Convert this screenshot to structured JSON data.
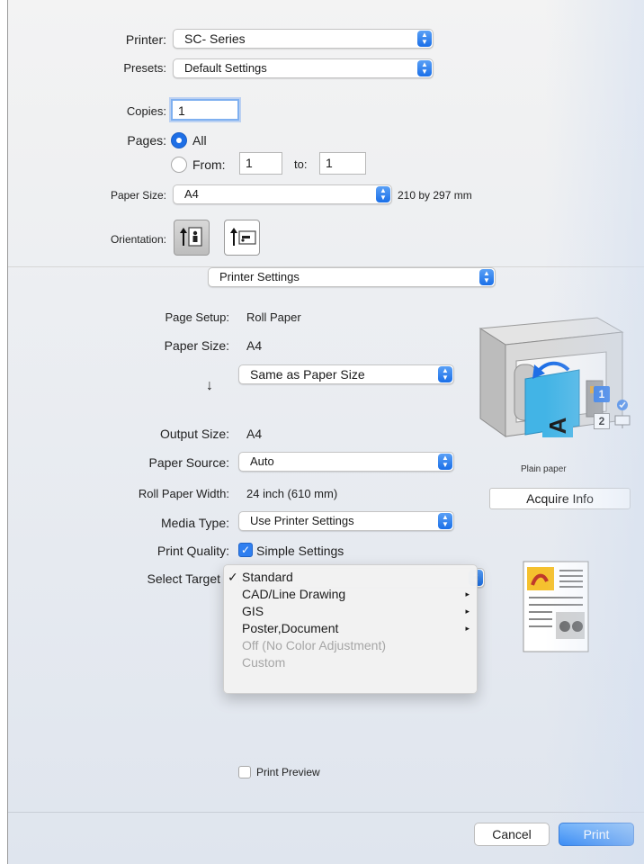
{
  "top": {
    "printer_label": "Printer:",
    "printer_value": "SC- Series",
    "presets_label": "Presets:",
    "presets_value": "Default Settings",
    "copies_label": "Copies:",
    "copies_value": "1",
    "pages_label": "Pages:",
    "pages_all": "All",
    "pages_from": "From:",
    "from_value": "1",
    "to_label": "to:",
    "to_value": "1",
    "paper_size_label": "Paper Size:",
    "paper_size_value": "A4",
    "paper_dims": "210 by 297 mm",
    "orientation_label": "Orientation:"
  },
  "panel_select": "Printer Settings",
  "settings": {
    "page_setup_label": "Page Setup:",
    "page_setup_value": "Roll Paper",
    "paper_size_label": "Paper Size:",
    "paper_size_value": "A4",
    "same_as_paper": "Same as Paper Size",
    "down_arrow": "↓",
    "output_size_label": "Output Size:",
    "output_size_value": "A4",
    "paper_source_label": "Paper Source:",
    "paper_source_value": "Auto",
    "roll_width_label": "Roll Paper Width:",
    "roll_width_value": "24 inch (610 mm)",
    "media_type_label": "Media Type:",
    "media_type_value": "Use Printer Settings",
    "print_quality_label": "Print Quality:",
    "simple_settings": "Simple Settings",
    "select_target_label": "Select Target"
  },
  "printer_panel": {
    "paper_caption": "Plain paper",
    "acquire_info": "Acquire Info",
    "badge_1": "1",
    "badge_2": "2",
    "sheet_letter": "A"
  },
  "menu": {
    "items": [
      {
        "label": "Standard",
        "checked": true,
        "submenu": false,
        "disabled": false
      },
      {
        "label": "CAD/Line Drawing",
        "checked": false,
        "submenu": true,
        "disabled": false
      },
      {
        "label": "GIS",
        "checked": false,
        "submenu": true,
        "disabled": false
      },
      {
        "label": "Poster,Document",
        "checked": false,
        "submenu": true,
        "disabled": false
      },
      {
        "label": "Off (No Color Adjustment)",
        "checked": false,
        "submenu": false,
        "disabled": true
      },
      {
        "label": "Custom",
        "checked": false,
        "submenu": false,
        "disabled": true
      }
    ],
    "checkmark": "✓",
    "submenu_arrow": "▸"
  },
  "bottom": {
    "print_preview": "Print Preview",
    "cancel": "Cancel",
    "print": "Print"
  },
  "colors": {
    "accent": "#1e6fe6",
    "window_bg": "#eef0f4"
  },
  "icons": {
    "popup": "updown-chevron-icon",
    "orientation_portrait": "portrait-orientation-icon",
    "orientation_landscape": "landscape-orientation-icon",
    "printer": "large-format-printer-icon",
    "target_thumb": "document-preview-icon"
  }
}
